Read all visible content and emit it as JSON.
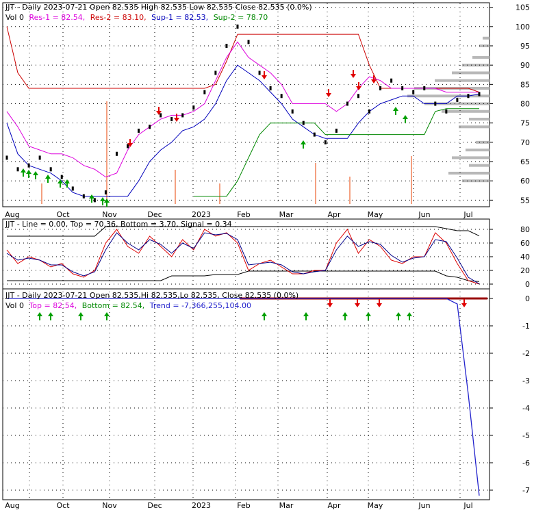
{
  "colors": {
    "frame": "#000000",
    "grid": "#000000",
    "resistance": "#cc0000",
    "resistance2": "#dd00dd",
    "support": "#0000bb",
    "support2": "#008800",
    "price": "#000000",
    "volume": "#f4a080",
    "volume_profile": "#b8b8b8",
    "arrow_up": "#00a000",
    "arrow_down": "#e00000",
    "trend": "#2222cc",
    "macd_line": "#dd0000",
    "stoch_line": "#000088"
  },
  "x_axis": {
    "month_labels": [
      "Aug",
      "Oct",
      "Nov",
      "Dec",
      "2023",
      "Feb",
      "Mar",
      "Apr",
      "May",
      "Jun",
      "Jul"
    ]
  },
  "chart_data": [
    {
      "type": "line",
      "name": "price-panel",
      "header": {
        "line1": "JJT - Daily 2023-07-21 Open 82.535  High 82.535  Low 82.535  Close 82.535 (0.0%)",
        "vol": "Vol 0",
        "res1": "Res-1 = 82.54,",
        "res2": "Res-2 = 83.10,",
        "sup1": "Sup-1 = 82.53,",
        "sup2": "Sup-2 = 78.70"
      },
      "ylim": [
        54,
        106
      ],
      "y_ticks": [
        55,
        60,
        65,
        70,
        75,
        80,
        85,
        90,
        95,
        100,
        105
      ],
      "series": [
        {
          "role": "close",
          "values": [
            66,
            63,
            64,
            66,
            63,
            61,
            58,
            56,
            55,
            57,
            67,
            69,
            73,
            74,
            77,
            76,
            77,
            79,
            83,
            88,
            95,
            100,
            96,
            88,
            84,
            82,
            78,
            75,
            72,
            70,
            73,
            80,
            82,
            78,
            84,
            86,
            84,
            83,
            84,
            80,
            78,
            81,
            82,
            82.5
          ]
        },
        {
          "role": "res-1",
          "values": [
            100,
            88,
            84,
            84,
            84,
            84,
            84,
            84,
            84,
            84,
            84,
            84,
            84,
            84,
            84,
            84,
            84,
            84,
            84,
            85,
            91,
            98,
            98,
            98,
            98,
            98,
            98,
            98,
            98,
            98,
            98,
            98,
            98,
            90,
            84,
            84,
            84,
            84,
            84,
            84,
            84,
            84,
            84,
            83
          ]
        },
        {
          "role": "res-2",
          "values": [
            78,
            74,
            69,
            68,
            67,
            67,
            66,
            64,
            63,
            61,
            62,
            68,
            72,
            74,
            76,
            77,
            77,
            78,
            80,
            86,
            92,
            96,
            92,
            90,
            88,
            85,
            80,
            80,
            80,
            80,
            78,
            80,
            84,
            87,
            86,
            84,
            84,
            84,
            84,
            84,
            83,
            83,
            83,
            83
          ]
        },
        {
          "role": "sup-1",
          "values": [
            75,
            67,
            64,
            63,
            62,
            60,
            57,
            56,
            56,
            56,
            56,
            56,
            60,
            65,
            68,
            70,
            73,
            74,
            76,
            80,
            86,
            90,
            88,
            86,
            83,
            80,
            76,
            74,
            72,
            71,
            71,
            71,
            75,
            78,
            80,
            81,
            82,
            82,
            80,
            80,
            80,
            82,
            82,
            82.5
          ]
        },
        {
          "role": "sup-2",
          "values": [
            null,
            null,
            null,
            null,
            null,
            null,
            null,
            null,
            null,
            null,
            null,
            null,
            null,
            null,
            null,
            null,
            null,
            56,
            56,
            56,
            56,
            60,
            66,
            72,
            75,
            75,
            75,
            75,
            75,
            72,
            72,
            72,
            72,
            72,
            72,
            72,
            72,
            72,
            72,
            78,
            78.7,
            78.7,
            78.7,
            78.7
          ]
        }
      ]
    },
    {
      "type": "line",
      "name": "oscillator-panel",
      "header": {
        "line1": "JJT - Line = 0.00, Top = 70.36, Bottom = 3.70, Signal = 0.34"
      },
      "ylim": [
        -5,
        90
      ],
      "y_ticks": [
        0,
        20,
        40,
        60,
        80
      ],
      "series": [
        {
          "role": "top",
          "values": [
            70,
            70,
            70,
            70,
            70,
            70,
            70,
            70,
            70,
            84,
            84,
            84,
            84,
            84,
            84,
            84,
            84,
            84,
            84,
            84,
            84,
            84,
            84,
            84,
            84,
            84,
            84,
            84,
            84,
            84,
            84,
            84,
            84,
            84,
            84,
            84,
            84,
            84,
            84,
            84,
            81,
            78,
            78,
            70.36
          ]
        },
        {
          "role": "bottom",
          "values": [
            5,
            5,
            5,
            5,
            5,
            5,
            5,
            5,
            5,
            5,
            5,
            5,
            5,
            5,
            5,
            12,
            12,
            12,
            12,
            14,
            14,
            14,
            19,
            19,
            19,
            19,
            19,
            19,
            19,
            19,
            19,
            19,
            19,
            19,
            19,
            19,
            19,
            19,
            19,
            19,
            12,
            10,
            5,
            3.7
          ]
        },
        {
          "role": "line",
          "values": [
            50,
            30,
            40,
            35,
            25,
            30,
            15,
            10,
            20,
            60,
            80,
            55,
            45,
            70,
            55,
            40,
            65,
            50,
            80,
            70,
            75,
            60,
            20,
            30,
            35,
            25,
            15,
            15,
            20,
            20,
            60,
            80,
            45,
            65,
            55,
            35,
            30,
            40,
            40,
            75,
            60,
            30,
            5,
            0
          ]
        },
        {
          "role": "signal",
          "values": [
            45,
            35,
            38,
            35,
            28,
            28,
            18,
            12,
            18,
            50,
            75,
            60,
            50,
            65,
            58,
            45,
            60,
            52,
            75,
            72,
            74,
            65,
            28,
            30,
            32,
            28,
            18,
            15,
            18,
            20,
            50,
            70,
            55,
            62,
            58,
            42,
            32,
            38,
            40,
            65,
            62,
            38,
            10,
            0.34
          ]
        }
      ]
    },
    {
      "type": "line",
      "name": "trend-panel",
      "header": {
        "line1": "JJT - Daily 2023-07-21 Open 82.535,Hi 82.535,Lo 82.535, Close 82.535 (0.0%)",
        "vol": "Vol 0",
        "top": "Top = 82.54,",
        "bottom": "Bottom = 82.54,",
        "trend": "Trend = -7,366,255,104.00"
      },
      "ylim": [
        -7.3,
        0.25
      ],
      "y_ticks": [
        -7,
        -6,
        -5,
        -4,
        -3,
        -2,
        -1,
        0
      ],
      "series": [
        {
          "role": "trend",
          "values": [
            0,
            0,
            0,
            0,
            0,
            0,
            0,
            0,
            0,
            0,
            0,
            0,
            0,
            0,
            0,
            0,
            0,
            0,
            0,
            0,
            0,
            0,
            0,
            0,
            0,
            0,
            0,
            0,
            0,
            0,
            0,
            0,
            0,
            0,
            0,
            0,
            0,
            0,
            0,
            0,
            0,
            -0.2,
            -3.5,
            -7.2
          ]
        }
      ]
    }
  ]
}
